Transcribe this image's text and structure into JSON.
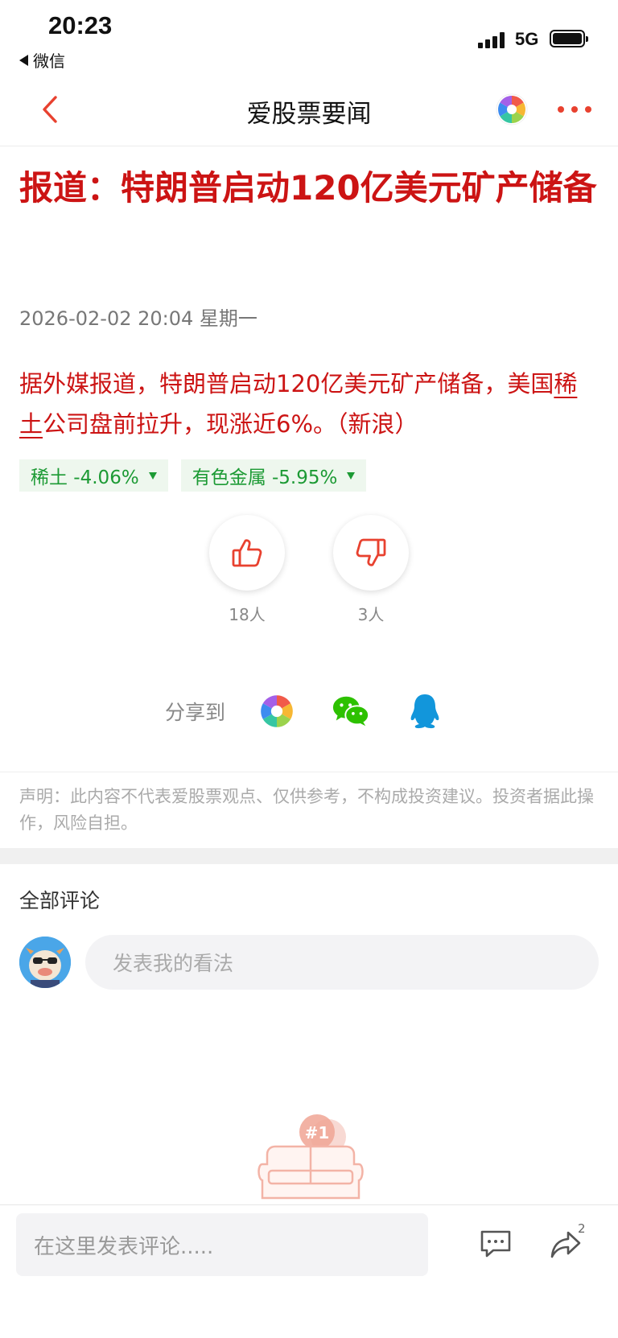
{
  "status_bar": {
    "time": "20:23",
    "back_app": "微信",
    "network": "5G"
  },
  "nav": {
    "title": "爱股票要闻"
  },
  "article": {
    "headline": "报道：特朗普启动120亿美元矿产储备",
    "datetime": "2026-02-02 20:04 星期一",
    "body_part1": "据外媒报道，特朗普启动120亿美元矿产储备，美国",
    "body_link": "稀土",
    "body_part2": "公司盘前拉升，现涨近6%。（新浪）",
    "tags": [
      {
        "label": "稀土 -4.06%",
        "trend": "down"
      },
      {
        "label": "有色金属 -5.95%",
        "trend": "down"
      }
    ],
    "likes": "18人",
    "dislikes": "3人"
  },
  "share": {
    "label": "分享到",
    "targets": [
      "aigupiao-icon",
      "wechat-icon",
      "qq-icon"
    ]
  },
  "disclaimer": "声明：此内容不代表爱股票观点、仅供参考，不构成投资建议。投资者据此操作，风险自担。",
  "comments": {
    "title": "全部评论",
    "input_placeholder": "发表我的看法",
    "empty_badge": "#1"
  },
  "bottom_bar": {
    "input_placeholder": "在这里发表评论.....",
    "share_count": "2"
  },
  "colors": {
    "accent_red": "#cc1414",
    "nav_red": "#e8412f",
    "down_green": "#1c9a34"
  }
}
